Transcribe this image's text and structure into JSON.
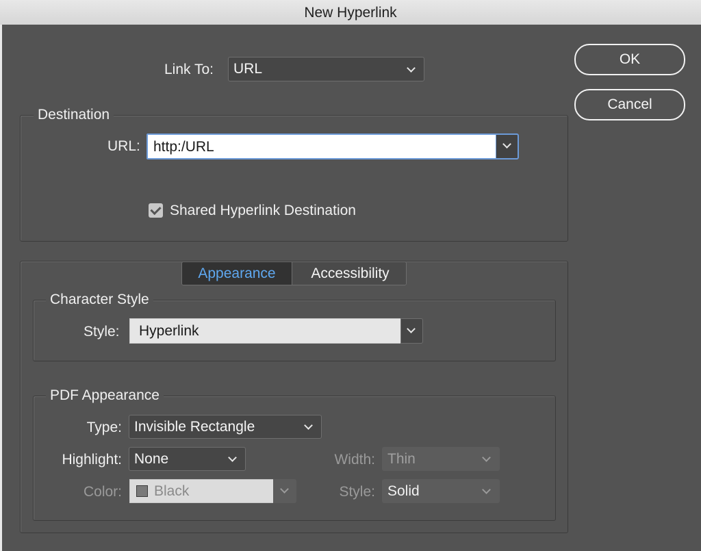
{
  "window": {
    "title": "New Hyperlink"
  },
  "buttons": {
    "ok": "OK",
    "cancel": "Cancel"
  },
  "link_to": {
    "label": "Link To:",
    "value": "URL"
  },
  "destination": {
    "legend": "Destination",
    "url_label": "URL:",
    "url_value": "http:/URL",
    "shared_label": "Shared Hyperlink Destination",
    "shared_checked": true
  },
  "tabs": [
    {
      "label": "Appearance",
      "active": true
    },
    {
      "label": "Accessibility",
      "active": false
    }
  ],
  "character_style": {
    "legend": "Character Style",
    "style_label": "Style:",
    "style_value": "Hyperlink"
  },
  "pdf_appearance": {
    "legend": "PDF Appearance",
    "type_label": "Type:",
    "type_value": "Invisible Rectangle",
    "highlight_label": "Highlight:",
    "highlight_value": "None",
    "color_label": "Color:",
    "color_value": "Black",
    "width_label": "Width:",
    "width_value": "Thin",
    "style_label": "Style:",
    "style_value": "Solid"
  },
  "colors": {
    "dialog_bg": "#535353",
    "active_tab_text": "#5fa8f0",
    "focus_ring": "#6c9ad8"
  }
}
